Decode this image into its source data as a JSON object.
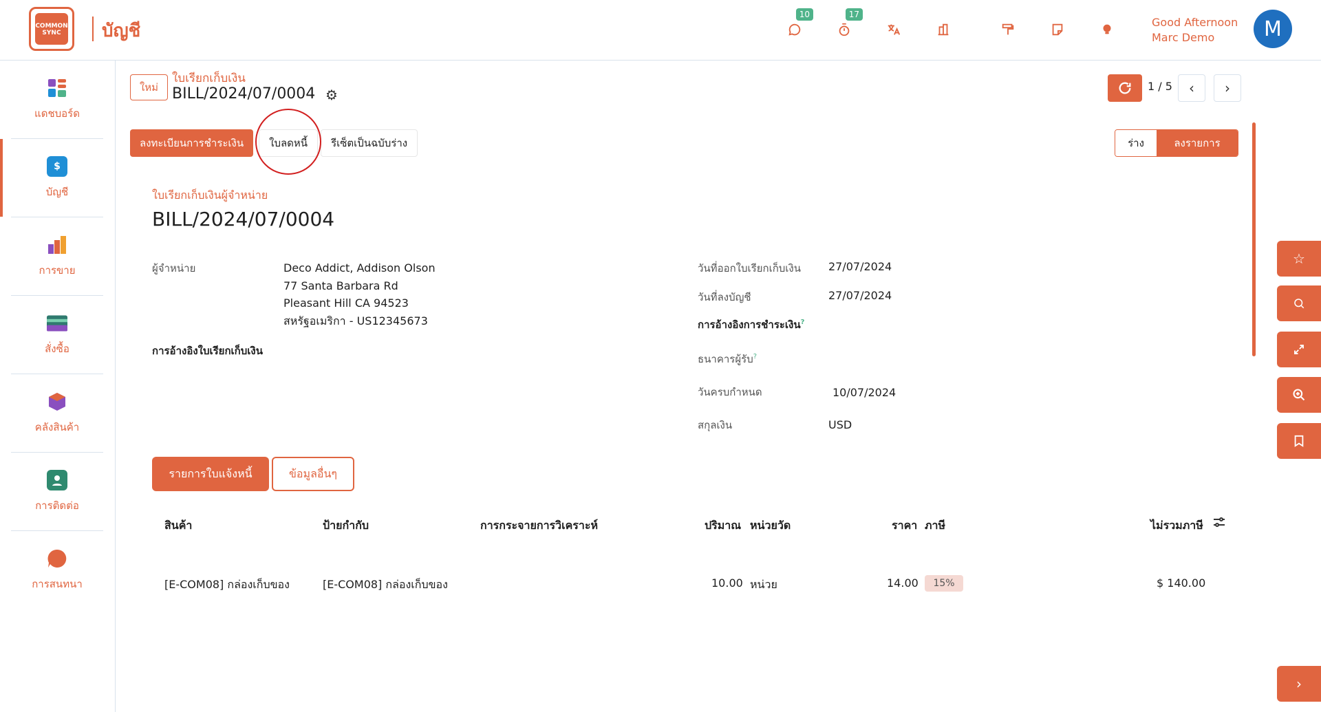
{
  "app": {
    "logo_text": "COMMON SYNC",
    "name": "บัญชี"
  },
  "topbar": {
    "chat_badge": "10",
    "timer_badge": "17",
    "greeting": "Good Afternoon",
    "user": "Marc Demo",
    "avatar_initial": "M"
  },
  "sidebar": {
    "items": [
      {
        "label": "แดชบอร์ด",
        "color": "#e06540"
      },
      {
        "label": "บัญชี",
        "color": "#1f8fd6"
      },
      {
        "label": "การขาย",
        "color": "#e06540"
      },
      {
        "label": "สั่งซื้อ",
        "color": "#2f7a6f"
      },
      {
        "label": "คลังสินค้า",
        "color": "#8a4fbf"
      },
      {
        "label": "การติดต่อ",
        "color": "#2f8a6f"
      },
      {
        "label": "การสนทนา",
        "color": "#e06540"
      }
    ]
  },
  "header": {
    "new_label": "ใหม่",
    "breadcrumb": "ใบเรียกเก็บเงิน",
    "title": "BILL/2024/07/0004",
    "pager": "1 / 5"
  },
  "actions": {
    "register_payment": "ลงทะเบียนการชำระเงิน",
    "credit_note": "ใบลดหนี้",
    "reset_draft": "รีเซ็ตเป็นฉบับร่าง",
    "status_draft": "ร่าง",
    "status_posted": "ลงรายการ"
  },
  "form": {
    "subtitle": "ใบเรียกเก็บเงินผู้จำหน่าย",
    "title": "BILL/2024/07/0004",
    "vendor_label": "ผู้จำหน่าย",
    "vendor_name": "Deco Addict, Addison Olson",
    "vendor_addr1": "77 Santa Barbara Rd",
    "vendor_addr2": "Pleasant Hill CA 94523",
    "vendor_addr3": "สหรัฐอเมริกา - US12345673",
    "bill_ref_label": "การอ้างอิงใบเรียกเก็บเงิน",
    "bill_date_label": "วันที่ออกใบเรียกเก็บเงิน",
    "bill_date": "27/07/2024",
    "acc_date_label": "วันที่ลงบัญชี",
    "acc_date": "27/07/2024",
    "pay_ref_label": "การอ้างอิงการชำระเงิน",
    "bank_label": "ธนาคารผู้รับ",
    "due_label": "วันครบกำหนด",
    "due_date": "10/07/2024",
    "currency_label": "สกุลเงิน",
    "currency": "USD"
  },
  "tabs": {
    "lines": "รายการใบแจ้งหนี้",
    "other": "ข้อมูลอื่นๆ"
  },
  "table": {
    "headers": [
      "สินค้า",
      "ป้ายกำกับ",
      "การกระจายการวิเคราะห์",
      "ปริมาณ",
      "หน่วยวัด",
      "ราคา",
      "ภาษี",
      "ไม่รวมภาษี"
    ],
    "row": {
      "product": "[E-COM08] กล่องเก็บของ",
      "label": "[E-COM08] กล่องเก็บของ",
      "qty": "10.00",
      "uom": "หน่วย",
      "price": "14.00",
      "tax": "15%",
      "subtotal": "$ 140.00"
    }
  }
}
